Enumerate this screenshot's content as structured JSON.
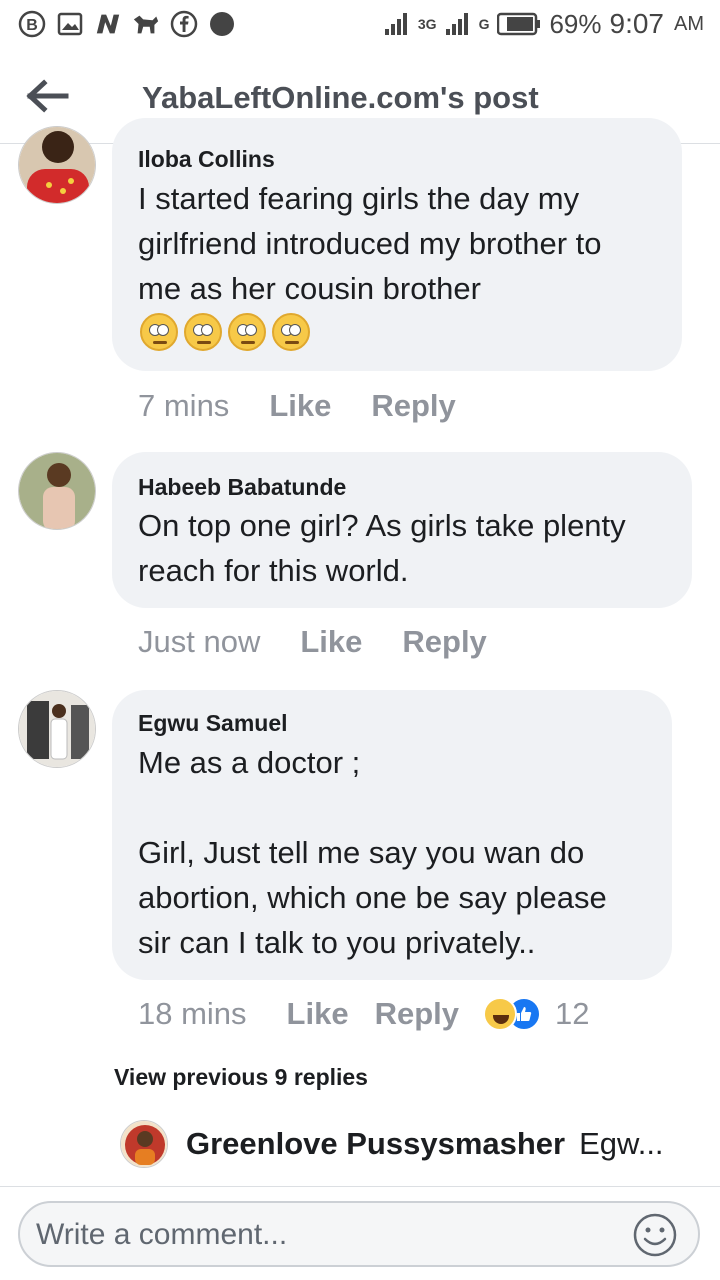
{
  "status_bar": {
    "network_3g": "3G",
    "network_g": "G",
    "battery": "69%",
    "time": "9:07",
    "ampm": "AM",
    "left_icons": [
      "b-circle-icon",
      "image-icon",
      "n-logo-icon",
      "dog-icon",
      "facebook-icon",
      "dot-icon"
    ]
  },
  "header": {
    "title": "YabaLeftOnline.com's post"
  },
  "comments": [
    {
      "name": "Iloba Collins",
      "text": "I started fearing girls the day my\ngirlfriend introduced my brother to\nme as her cousin brother",
      "emojis": [
        "rolling-eyes",
        "rolling-eyes",
        "rolling-eyes",
        "rolling-eyes"
      ],
      "time": "7 mins",
      "like": "Like",
      "reply": "Reply"
    },
    {
      "name": "Habeeb Babatunde",
      "text": "On top one girl? As girls take plenty\nreach for this world.",
      "time": "Just now",
      "like": "Like",
      "reply": "Reply"
    },
    {
      "name": "Egwu Samuel",
      "text": "Me as a doctor ;\n\nGirl, Just tell me say you wan do\nabortion, which one be say please\nsir can I talk to you privately..",
      "time": "18 mins",
      "like": "Like",
      "reply": "Reply",
      "reactions": [
        "haha",
        "like"
      ],
      "reaction_count": "12"
    }
  ],
  "replies": {
    "view_previous": "View previous 9 replies",
    "last_reply_name": "Greenlove Pussysmasher",
    "last_reply_preview": "Egw..."
  },
  "composer": {
    "placeholder": "Write a comment..."
  },
  "colors": {
    "bubble": "#f0f2f5",
    "meta_text": "#90949c",
    "header_text": "#4b4f56",
    "like_blue": "#1877f2"
  }
}
